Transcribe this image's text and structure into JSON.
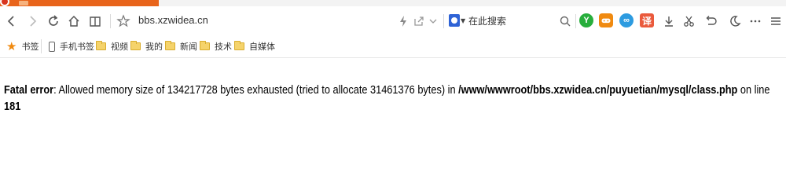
{
  "window": {
    "url": "bbs.xzwidea.cn"
  },
  "toolbar": {
    "search_placeholder": "在此搜索",
    "ext_translate_label": "译",
    "ext_green_label": "Y",
    "ext_blue_label": "∞"
  },
  "bookmarks": [
    {
      "label": "书签",
      "icon": "star-icon"
    },
    {
      "label": "手机书签",
      "icon": "phone-icon"
    },
    {
      "label": "视频",
      "icon": "folder-icon"
    },
    {
      "label": "我的",
      "icon": "folder-icon"
    },
    {
      "label": "新闻",
      "icon": "folder-icon"
    },
    {
      "label": "技术",
      "icon": "folder-icon"
    },
    {
      "label": "自媒体",
      "icon": "folder-icon"
    }
  ],
  "page": {
    "error_label": "Fatal error",
    "error_message": ": Allowed memory size of 134217728 bytes exhausted (tried to allocate 31461376 bytes) in ",
    "file_path": "/www/wwwroot/bbs.xzwidea.cn/puyuetian/mysql/class.php",
    "on_line_text": " on line ",
    "line_number": "181"
  },
  "colors": {
    "tab_accent": "#e8641b",
    "bookmark_star": "#f08a10",
    "folder": "#f5d36b"
  }
}
